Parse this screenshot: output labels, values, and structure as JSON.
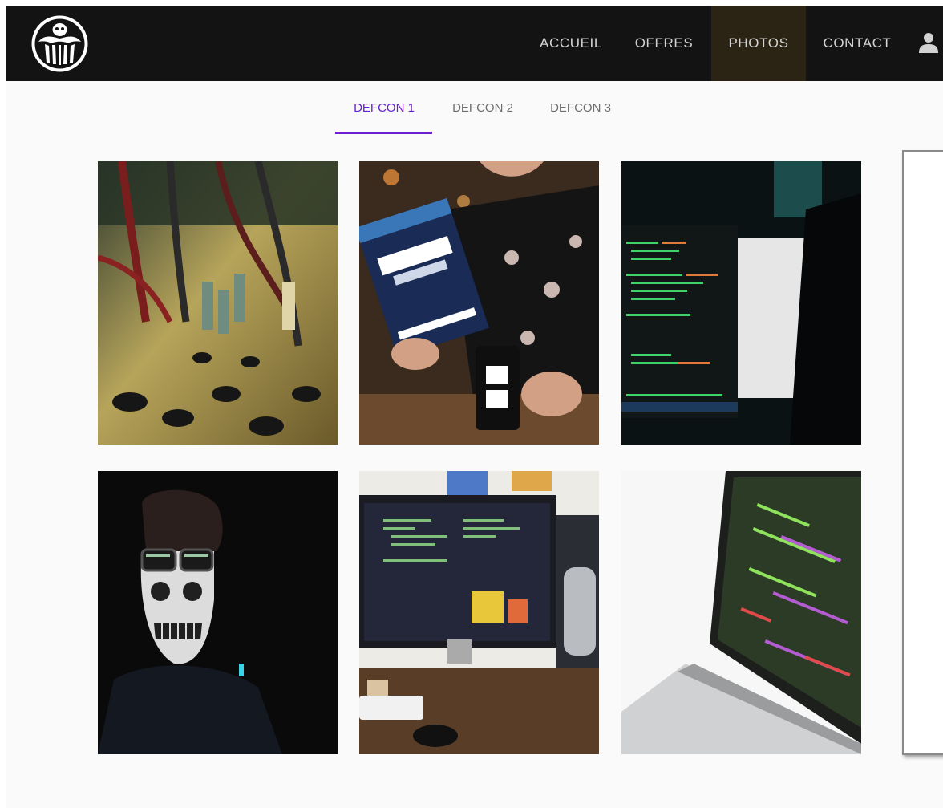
{
  "navbar": {
    "logo_icon": "spider-skull-logo-icon",
    "items": [
      {
        "label": "ACCUEIL",
        "active": false
      },
      {
        "label": "OFFRES",
        "active": false
      },
      {
        "label": "PHOTOS",
        "active": true
      },
      {
        "label": "CONTACT",
        "active": false
      }
    ],
    "user_icon": "user-icon"
  },
  "tabs": [
    {
      "label": "DEFCON 1",
      "active": true
    },
    {
      "label": "DEFCON 2",
      "active": false
    },
    {
      "label": "DEFCON 3",
      "active": false
    }
  ],
  "gallery": {
    "photos": [
      {
        "subject": "audio-mixer"
      },
      {
        "subject": "man-reading-book"
      },
      {
        "subject": "code-on-monitor"
      },
      {
        "subject": "hacker-skull-mask"
      },
      {
        "subject": "desk-monitor-setup"
      },
      {
        "subject": "laptop-code-screen"
      }
    ]
  },
  "colors": {
    "navbar_bg": "#131313",
    "nav_active_bg": "#2b2414",
    "tab_accent": "#6a1fd1",
    "page_bg": "#fafafa"
  }
}
